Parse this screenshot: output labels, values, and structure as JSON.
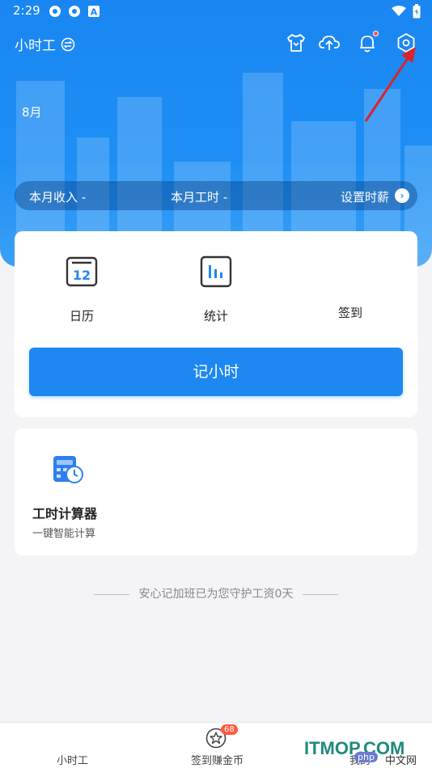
{
  "status": {
    "time": "2:29"
  },
  "header": {
    "mode_label": "小时工",
    "month": "8月"
  },
  "summary": {
    "income": "本月收入 -",
    "hours": "本月工时 -",
    "set_wage": "设置时薪"
  },
  "main": {
    "entries": [
      {
        "label": "日历",
        "icon": "calendar-icon",
        "number": "12"
      },
      {
        "label": "统计",
        "icon": "stats-icon"
      },
      {
        "label": "签到",
        "icon": "checkin-icon"
      }
    ],
    "record_button": "记小时"
  },
  "tool": {
    "title": "工时计算器",
    "subtitle": "一键智能计算"
  },
  "footer_note": "安心记加班已为您守护工资0天",
  "tabbar": {
    "tabs": [
      {
        "label": "小时工"
      },
      {
        "label": "签到赚金币",
        "badge": "68"
      },
      {
        "label": "我的"
      }
    ]
  },
  "watermark": {
    "main": "ITMOP.COM",
    "php": "php",
    "cn": "中文网"
  },
  "colors": {
    "primary": "#1d88f2",
    "badge": "#ff5a3c",
    "annotation_arrow": "#d9232e"
  }
}
